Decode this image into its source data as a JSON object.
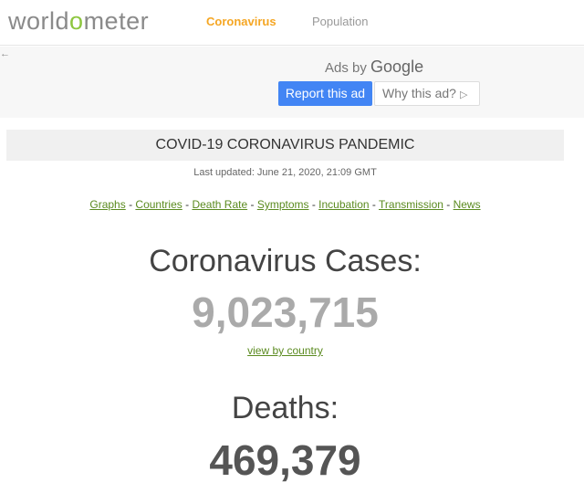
{
  "nav": {
    "logo_prefix": "world",
    "logo_o": "o",
    "logo_suffix": "meter",
    "coronavirus": "Coronavirus",
    "population": "Population"
  },
  "ad": {
    "ads_by": "Ads by",
    "google": "Google",
    "report": "Report this ad",
    "why": "Why this ad?",
    "back_icon": "back-arrow-icon",
    "why_icon": "play-triangle-icon"
  },
  "header": {
    "title": "COVID-19 CORONAVIRUS PANDEMIC",
    "updated": "Last updated: June 21, 2020, 21:09 GMT"
  },
  "links": [
    "Graphs",
    "Countries",
    "Death Rate",
    "Symptoms",
    "Incubation",
    "Transmission",
    "News"
  ],
  "links_separator": " - ",
  "cases": {
    "label": "Coronavirus Cases:",
    "value": "9,023,715",
    "view_link": "view by country"
  },
  "deaths": {
    "label": "Deaths:",
    "value": "469,379"
  },
  "colors": {
    "accent_orange": "#f5a623",
    "link_green": "#5a8a1f",
    "logo_green": "#8dc63f",
    "google_blue": "#4285f4"
  }
}
